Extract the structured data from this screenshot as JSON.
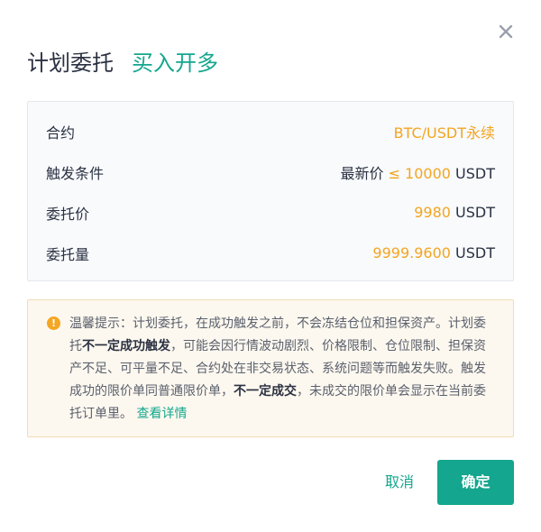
{
  "dialog": {
    "title": "计划委托",
    "subtitle": "买入开多",
    "close_icon": "close-icon"
  },
  "details": [
    {
      "label": "合约",
      "parts": [
        {
          "text": "BTC/USDT永续",
          "color": "#f4a521"
        }
      ]
    },
    {
      "label": "触发条件",
      "parts": [
        {
          "text": "最新价 "
        },
        {
          "text": "≤ 10000",
          "color": "#f4a521"
        },
        {
          "text": " USDT"
        }
      ]
    },
    {
      "label": "委托价",
      "parts": [
        {
          "text": "9980",
          "color": "#f4a521"
        },
        {
          "text": " USDT"
        }
      ]
    },
    {
      "label": "委托量",
      "parts": [
        {
          "text": "9999.9600",
          "color": "#f4a521"
        },
        {
          "text": " USDT"
        }
      ]
    }
  ],
  "notice": {
    "icon": "warning-icon",
    "text1": "温馨提示：计划委托，在成功触发之前，不会冻结仓位和担保资产。计划委托",
    "bold1": "不一定成功触发",
    "text2": "，可能会因行情波动剧烈、价格限制、仓位限制、担保资产不足、可平量不足、合约处在非交易状态、系统问题等而触发失败。触发成功的限价单同普通限价单，",
    "bold2": "不一定成交",
    "text3": "，未成交的限价单会显示在当前委托订单里。",
    "link": "查看详情"
  },
  "buttons": {
    "cancel": "取消",
    "confirm": "确定"
  },
  "colors": {
    "accent": "#14a68e",
    "highlight": "#f4a521"
  }
}
